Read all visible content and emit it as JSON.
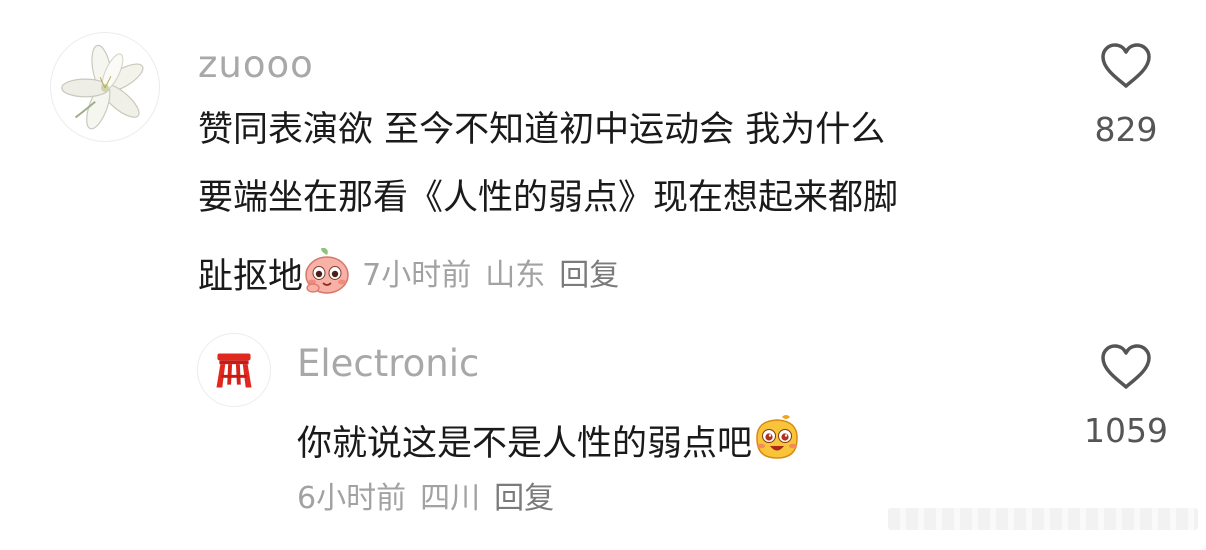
{
  "comment": {
    "username": "zuooo",
    "text_lines": [
      "赞同表演欲 至今不知道初中运动会 我为什么",
      "要端坐在那看《人性的弱点》现在想起来都脚",
      "趾抠地"
    ],
    "time": "7小时前",
    "location": "山东",
    "reply_label": "回复",
    "like_count": "829"
  },
  "reply": {
    "username": "Electronic",
    "text": "你就说这是不是人性的弱点吧",
    "time": "6小时前",
    "location": "四川",
    "reply_label": "回复",
    "like_count": "1059"
  }
}
